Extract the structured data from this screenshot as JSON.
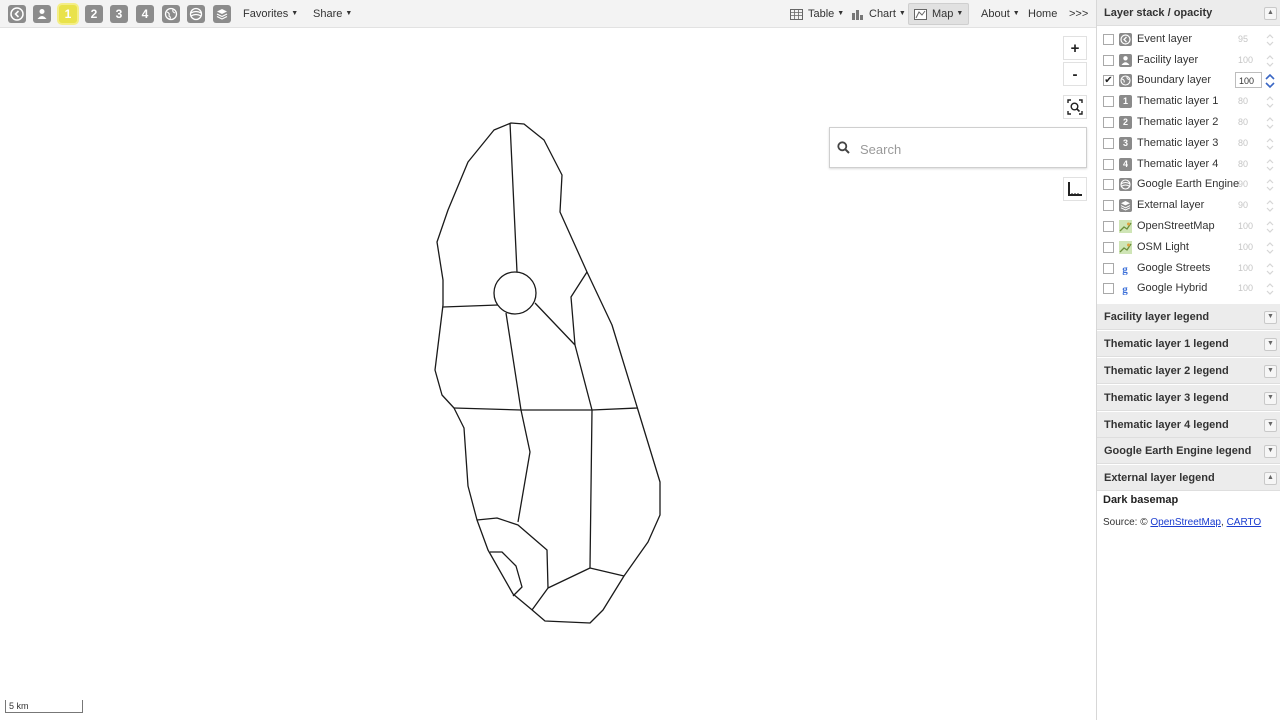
{
  "toolbar": {
    "layer_buttons": [
      "1",
      "2",
      "3",
      "4"
    ],
    "favorites_label": "Favorites",
    "share_label": "Share",
    "table_label": "Table",
    "chart_label": "Chart",
    "map_label": "Map",
    "about_label": "About",
    "home_label": "Home",
    "more_label": ">>>"
  },
  "map": {
    "zoom_in": "+",
    "zoom_out": "-",
    "search_placeholder": "Search",
    "scale_label": "5 km"
  },
  "panel": {
    "layer_stack_title": "Layer stack / opacity",
    "layers": [
      {
        "label": "Event layer",
        "opacity": "95",
        "checked": false,
        "icon": "event-icon"
      },
      {
        "label": "Facility layer",
        "opacity": "100",
        "checked": false,
        "icon": "facility-icon"
      },
      {
        "label": "Boundary layer",
        "opacity": "100",
        "checked": true,
        "icon": "boundary-icon"
      },
      {
        "label": "Thematic layer 1",
        "opacity": "80",
        "checked": false,
        "icon": "1"
      },
      {
        "label": "Thematic layer 2",
        "opacity": "80",
        "checked": false,
        "icon": "2"
      },
      {
        "label": "Thematic layer 3",
        "opacity": "80",
        "checked": false,
        "icon": "3"
      },
      {
        "label": "Thematic layer 4",
        "opacity": "80",
        "checked": false,
        "icon": "4"
      },
      {
        "label": "Google Earth Engine",
        "opacity": "90",
        "checked": false,
        "icon": "earth-engine-icon"
      },
      {
        "label": "External layer",
        "opacity": "90",
        "checked": false,
        "icon": "external-layer-icon"
      },
      {
        "label": "OpenStreetMap",
        "opacity": "100",
        "checked": false,
        "icon": "osm-icon"
      },
      {
        "label": "OSM Light",
        "opacity": "100",
        "checked": false,
        "icon": "osm-icon"
      },
      {
        "label": "Google Streets",
        "opacity": "100",
        "checked": false,
        "icon": "google-icon"
      },
      {
        "label": "Google Hybrid",
        "opacity": "100",
        "checked": false,
        "icon": "google-icon"
      }
    ],
    "legends": [
      "Facility layer legend",
      "Thematic layer 1 legend",
      "Thematic layer 2 legend",
      "Thematic layer 3 legend",
      "Thematic layer 4 legend",
      "Google Earth Engine legend",
      "External layer legend"
    ],
    "dark_basemap_title": "Dark basemap",
    "attribution_prefix": "Source: ©",
    "attribution_links": [
      "OpenStreetMap",
      "CARTO"
    ],
    "attribution_sep": ","
  },
  "colors": {
    "active_button": "#e9e24a",
    "toolbar_bg": "#f3f3f3",
    "panel_header_bg": "#ececec",
    "link": "#1a3ccf"
  }
}
